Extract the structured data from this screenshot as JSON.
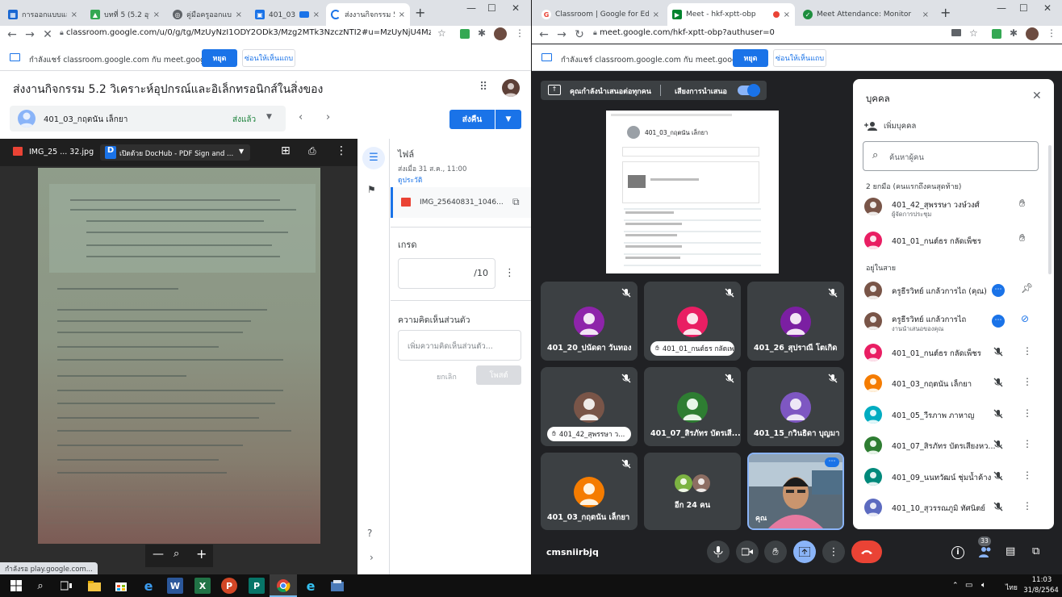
{
  "left_window": {
    "tabs": [
      {
        "title": "การออกแบบและฯ",
        "color": "#1967d2"
      },
      {
        "title": "บทที่ 5 (5.2 อุปกร",
        "color": "#34a853"
      },
      {
        "title": "คู่มือครูออกแบบแล",
        "color": "#5f6368"
      },
      {
        "title": "401_03_กฤ",
        "color": "#1a73e8"
      },
      {
        "title": "ส่งงานกิจกรรม 5.",
        "color": "#1a73e8"
      }
    ],
    "url": "classroom.google.com/u/0/g/tg/MzUyNzI1ODY2ODk3/Mzg2MTk3NzczNTI2#u=MzUyNjU4MzM0MzI...",
    "share_text": "กำลังแชร์ classroom.google.com กับ meet.google.com",
    "stop_label": "หยุด",
    "hide_label": "ซ่อนให้เห็นแถบ",
    "page_title": "ส่งงานกิจกรรม 5.2 วิเคราะห์อุปกรณ์และอิเล็กทรอนิกส์ในสิ่งของ",
    "student_name": "401_03_กฤตนัน เล็กยา",
    "status": "ส่งแล้ว",
    "return_label": "ส่งคืน",
    "file_name": "IMG_25 ... 32.jpg",
    "open_with": "เปิดด้วย DocHub - PDF Sign and ...",
    "files_heading": "ไฟล์",
    "submitted_at": "ส่งเมื่อ 31 ส.ค., 11:00",
    "history_link": "ดูประวัติ",
    "attachment_name": "IMG_25640831_1046...",
    "grade_heading": "เกรด",
    "grade_denominator": "/10",
    "private_comment_heading": "ความคิดเห็นส่วนตัว",
    "comment_placeholder": "เพิ่มความคิดเห็นส่วนตัว...",
    "cancel_label": "ยกเลิก",
    "post_label": "โพสต์",
    "status_bar": "กำลังรอ play.google.com..."
  },
  "right_window": {
    "tabs": [
      {
        "title": "Classroom | Google for Education",
        "color": "#ea4335"
      },
      {
        "title": "Meet - hkf-xptt-obp",
        "color": "#00832d"
      },
      {
        "title": "Meet Attendance: Monitor",
        "color": "#1e8e3e"
      }
    ],
    "url": "meet.google.com/hkf-xptt-obp?authuser=0",
    "share_text": "กำลังแชร์ classroom.google.com กับ meet.google.com",
    "stop_label": "หยุด",
    "hide_label": "ซ่อนให้เห็นแถบ",
    "presenting_banner": "คุณกำลังนำเสนอต่อทุกคน",
    "presentation_audio": "เสียงการนำเสนอ",
    "preview_name": "401_03_กฤตนัน เล็กยา",
    "tiles": [
      {
        "name": "401_20_ปนัดดา วันทอง",
        "color": "#8e24aa",
        "pill": false
      },
      {
        "name": "401_01_กนต์ธร กลัดเพ...",
        "color": "#e91e63",
        "pill": true
      },
      {
        "name": "401_26_สุปราณี โตเกิด",
        "color": "#7b1fa2",
        "pill": false
      },
      {
        "name": "401_42_สุพรรษา ว...",
        "color": "#795548",
        "pill": true
      },
      {
        "name": "401_07_สิรภัทร บัตรเสี...",
        "color": "#2e7d32",
        "pill": false
      },
      {
        "name": "401_15_กวินธิดา บุญมา",
        "color": "#7e57c2",
        "pill": false
      },
      {
        "name": "401_03_กฤตนัน เล็กยา",
        "color": "#f57c00",
        "pill": false
      }
    ],
    "others_label": "อีก 24 คน",
    "self_label": "คุณ",
    "meeting_code": "cmsniirbjq",
    "people_count": "33",
    "panel": {
      "title": "บุคคล",
      "add_people": "เพิ่มบุคคล",
      "search_placeholder": "ค้นหาผู้คน",
      "raised_heading": "2 ยกมือ (คนแรกถึงคนสุดท้าย)",
      "online_heading": "อยู่ในสาย",
      "raised": [
        {
          "name": "401_42_สุพรรษา วงษ์วงศ์",
          "sub": "ผู้จัดการประชุม",
          "color": "#795548"
        },
        {
          "name": "401_01_กนต์ธร กลัดเพ็ชร",
          "sub": "",
          "color": "#e91e63"
        }
      ],
      "people": [
        {
          "name": "ครูธีรวิทย์ แกล้วการไถ (คุณ)",
          "sub": "",
          "color": "#795548",
          "kind": "pin"
        },
        {
          "name": "ครูธีรวิทย์ แกล้วการไถ",
          "sub": "งานนำเสนอของคุณ",
          "color": "#795548",
          "kind": "present"
        },
        {
          "name": "401_01_กนต์ธร กลัดเพ็ชร",
          "sub": "",
          "color": "#e91e63",
          "kind": "normal"
        },
        {
          "name": "401_03_กฤตนัน เล็กยา",
          "sub": "",
          "color": "#f57c00",
          "kind": "normal"
        },
        {
          "name": "401_05_วีรภาพ ภาหาญ",
          "sub": "",
          "color": "#00acc1",
          "kind": "normal"
        },
        {
          "name": "401_07_สิรภัทร บัตรเสียงหว...",
          "sub": "",
          "color": "#2e7d32",
          "kind": "normal"
        },
        {
          "name": "401_09_นนทวัฒน์ ชุ่มน้ำค้าง",
          "sub": "",
          "color": "#00897b",
          "kind": "normal"
        },
        {
          "name": "401_10_สุวรรณภูมิ ทัศนิตย์",
          "sub": "",
          "color": "#5c6bc0",
          "kind": "normal"
        }
      ]
    }
  },
  "taskbar": {
    "time": "11:03",
    "date": "31/8/2564",
    "lang": "ไทย"
  }
}
